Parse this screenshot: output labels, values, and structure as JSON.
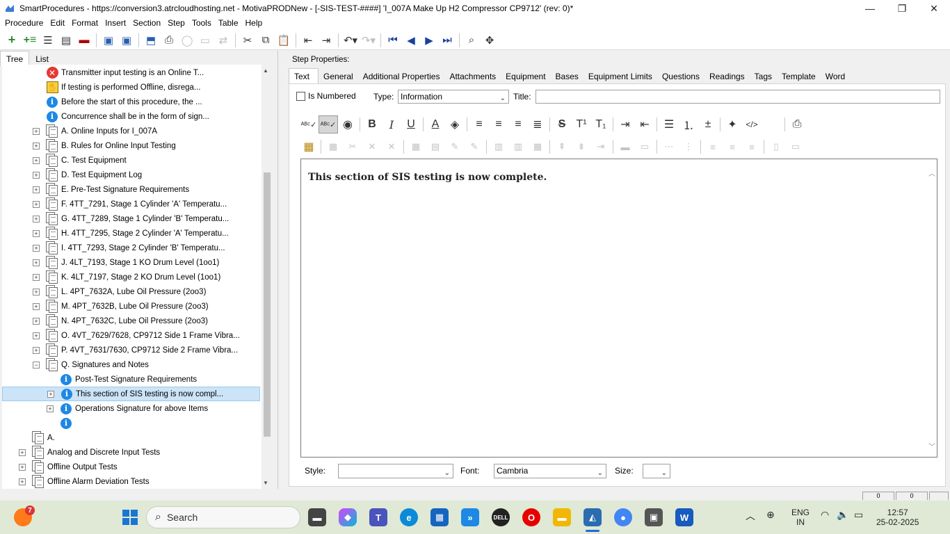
{
  "window": {
    "title": "SmartProcedures - https://conversion3.atrcloudhosting.net - MotivaPRODNew - [-SIS-TEST-####] 'I_007A Make Up H2 Compressor CP9712' (rev: 0)*",
    "minimize": "—",
    "maximize": "❐",
    "close": "✕"
  },
  "menu": [
    "Procedure",
    "Edit",
    "Format",
    "Insert",
    "Section",
    "Step",
    "Tools",
    "Table",
    "Help"
  ],
  "left_tabs": [
    "Tree",
    "List"
  ],
  "tree": {
    "rows": [
      {
        "label": "Transmitter input testing is an Online T...",
        "icon": "error-icon",
        "indent": 1,
        "expander": ""
      },
      {
        "label": "If testing is performed Offline, disrega...",
        "icon": "warning-icon",
        "indent": 1,
        "expander": ""
      },
      {
        "label": "Before the start of this procedure, the ...",
        "icon": "info-icon",
        "indent": 1,
        "expander": ""
      },
      {
        "label": "Concurrence shall be in the form of sign...",
        "icon": "info-icon",
        "indent": 1,
        "expander": ""
      },
      {
        "label": "A. Online Inputs for I_007A",
        "icon": "document-icon",
        "indent": 1,
        "expander": "+"
      },
      {
        "label": "B. Rules for Online Input Testing",
        "icon": "document-icon",
        "indent": 1,
        "expander": "+"
      },
      {
        "label": "C. Test Equipment",
        "icon": "document-icon",
        "indent": 1,
        "expander": "+"
      },
      {
        "label": "D. Test Equipment Log",
        "icon": "document-icon",
        "indent": 1,
        "expander": "+"
      },
      {
        "label": "E. Pre-Test Signature Requirements",
        "icon": "document-icon",
        "indent": 1,
        "expander": "+"
      },
      {
        "label": "F. 4TT_7291, Stage 1 Cylinder 'A' Temperatu...",
        "icon": "document-icon",
        "indent": 1,
        "expander": "+"
      },
      {
        "label": "G. 4TT_7289, Stage 1 Cylinder 'B' Temperatu...",
        "icon": "document-icon",
        "indent": 1,
        "expander": "+"
      },
      {
        "label": "H. 4TT_7295, Stage 2 Cylinder 'A' Temperatu...",
        "icon": "document-icon",
        "indent": 1,
        "expander": "+"
      },
      {
        "label": "I. 4TT_7293, Stage 2 Cylinder 'B' Temperatu...",
        "icon": "document-icon",
        "indent": 1,
        "expander": "+"
      },
      {
        "label": "J. 4LT_7193, Stage 1 KO Drum Level (1oo1)",
        "icon": "document-icon",
        "indent": 1,
        "expander": "+"
      },
      {
        "label": "K. 4LT_7197, Stage 2 KO Drum Level (1oo1)",
        "icon": "document-icon",
        "indent": 1,
        "expander": "+"
      },
      {
        "label": "L. 4PT_7632A, Lube Oil Pressure (2oo3)",
        "icon": "document-icon",
        "indent": 1,
        "expander": "+"
      },
      {
        "label": "M. 4PT_7632B, Lube Oil Pressure (2oo3)",
        "icon": "document-icon",
        "indent": 1,
        "expander": "+"
      },
      {
        "label": "N. 4PT_7632C, Lube Oil Pressure (2oo3)",
        "icon": "document-icon",
        "indent": 1,
        "expander": "+"
      },
      {
        "label": "O. 4VT_7629/7628, CP9712 Side 1 Frame Vibra...",
        "icon": "document-icon",
        "indent": 1,
        "expander": "+"
      },
      {
        "label": "P. 4VT_7631/7630, CP9712 Side 2 Frame Vibra...",
        "icon": "document-icon",
        "indent": 1,
        "expander": "+"
      },
      {
        "label": "Q. Signatures and Notes",
        "icon": "document-icon",
        "indent": 1,
        "expander": "−"
      },
      {
        "label": "Post-Test Signature Requirements",
        "icon": "info-icon",
        "indent": 2,
        "expander": ""
      },
      {
        "label": "This section of SIS testing is now compl...",
        "icon": "info-icon",
        "indent": 2,
        "expander": "+",
        "selected": true
      },
      {
        "label": "Operations Signature for above Items",
        "icon": "info-icon",
        "indent": 2,
        "expander": "+"
      },
      {
        "label": "",
        "icon": "info-icon",
        "indent": 2,
        "expander": ""
      },
      {
        "label": "A.",
        "icon": "document-icon",
        "indent": 0,
        "expander": ""
      },
      {
        "label": "Analog and Discrete Input Tests",
        "icon": "document-icon",
        "indent": 0,
        "expander": "+"
      },
      {
        "label": "Offline Output Tests",
        "icon": "document-icon",
        "indent": 0,
        "expander": "+"
      },
      {
        "label": "Offline Alarm Deviation Tests",
        "icon": "document-icon",
        "indent": 0,
        "expander": "+"
      }
    ]
  },
  "step": {
    "header": "Step Properties:",
    "tabs": [
      "Text",
      "General",
      "Additional Properties",
      "Attachments",
      "Equipment",
      "Bases",
      "Equipment Limits",
      "Questions",
      "Readings",
      "Tags",
      "Template",
      "Word"
    ],
    "active_tab": "Text",
    "is_numbered_label": "Is Numbered",
    "is_numbered_checked": false,
    "type_label": "Type:",
    "type_value": "Information",
    "title_label": "Title:",
    "title_value": "",
    "editor_text": "This section of SIS testing is now complete.",
    "style_label": "Style:",
    "style_value": "",
    "font_label": "Font:",
    "font_value": "Cambria",
    "size_label": "Size:",
    "size_value": ""
  },
  "taskbar": {
    "search_placeholder": "Search",
    "notification_count": "7",
    "language": "ENG",
    "region": "IN",
    "time": "12:57",
    "date": "25-02-2025"
  },
  "colors": {
    "accent_selection": "#cce4f7",
    "info_blue": "#1e88e5",
    "error_red": "#e53935",
    "taskbar_bg": "#dfe9d6"
  }
}
